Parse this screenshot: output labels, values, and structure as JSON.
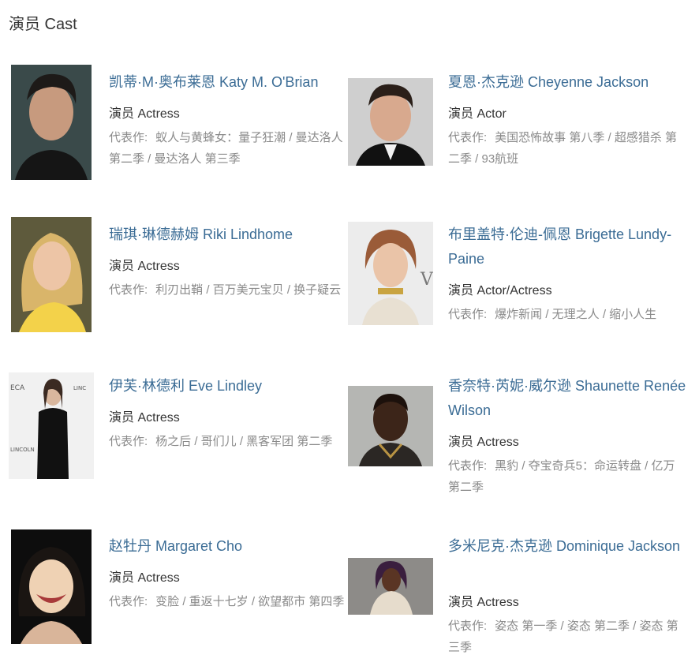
{
  "section": {
    "title": "演员 Cast"
  },
  "works_label": "代表作:",
  "cast": [
    {
      "name": "凯蒂·M·奥布莱恩 Katy M. O'Brian",
      "role": "演员 Actress",
      "works": "蚁人与黄蜂女：量子狂潮 / 曼达洛人 第二季 / 曼达洛人 第三季",
      "photo": "photo-katy"
    },
    {
      "name": "夏恩·杰克逊 Cheyenne Jackson",
      "role": "演员 Actor",
      "works": "美国恐怖故事 第八季 / 超感猎杀 第二季 / 93航班",
      "photo": "photo-cheyenne"
    },
    {
      "name": "瑞琪·琳德赫姆 Riki Lindhome",
      "role": "演员 Actress",
      "works": "利刃出鞘 / 百万美元宝贝 / 换子疑云",
      "photo": "photo-riki"
    },
    {
      "name": "布里盖特·伦迪-佩恩 Brigette Lundy-Paine",
      "role": "演员 Actor/Actress",
      "works": "爆炸新闻 / 无理之人 / 缩小人生",
      "photo": "photo-brigette"
    },
    {
      "name": "伊芙·林德利 Eve Lindley",
      "role": "演员 Actress",
      "works": "杨之后 / 哥们儿 / 黑客军团 第二季",
      "photo": "photo-eve"
    },
    {
      "name": "香奈特·芮妮·威尔逊 Shaunette Renée Wilson",
      "role": "演员 Actress",
      "works": "黑豹 / 夺宝奇兵5：命运转盘 / 亿万 第二季",
      "photo": "photo-shaunette"
    },
    {
      "name": "赵牡丹 Margaret Cho",
      "role": "演员 Actress",
      "works": "变脸 / 重返十七岁 / 欲望都市 第四季",
      "photo": "photo-margaret"
    },
    {
      "name": "多米尼克·杰克逊 Dominique Jackson",
      "role": "演员 Actress",
      "works": "姿态 第一季 / 姿态 第二季 / 姿态 第三季",
      "photo": "photo-dominique"
    }
  ]
}
